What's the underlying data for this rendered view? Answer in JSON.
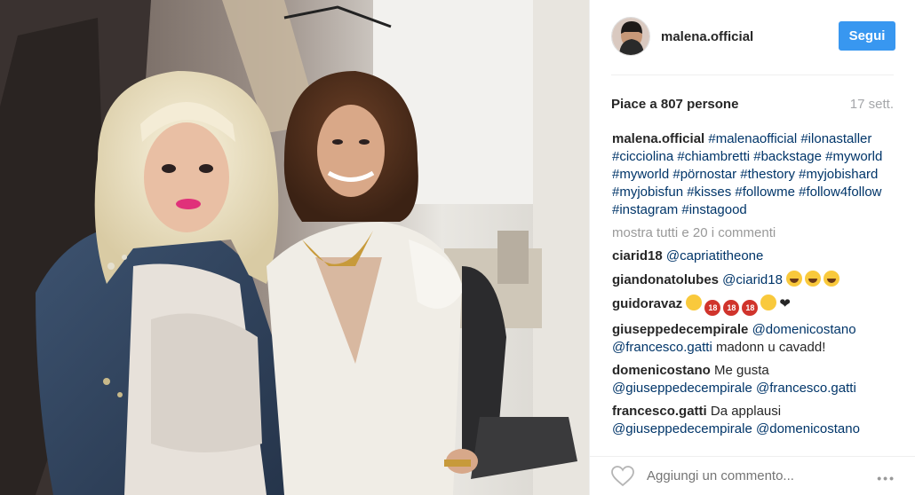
{
  "post": {
    "username": "malena.official",
    "follow_label": "Segui",
    "likes_text": "Piace a 807 persone",
    "time_text": "17 sett.",
    "load_more_text": "mostra tutti e 20 i commenti",
    "add_comment_placeholder": "Aggiungi un commento...",
    "more_options": "•••",
    "caption": {
      "user": "malena.official",
      "tags": [
        "#malenaofficial",
        "#ilonastaller",
        "#cicciolina",
        "#chiambretti",
        "#backstage",
        "#myworld",
        "#myworld",
        "#pörnostar",
        "#thestory",
        "#myjobishard",
        "#myjobisfun",
        "#kisses",
        "#followme",
        "#follow4follow",
        "#instagram",
        "#instagood"
      ]
    },
    "comments": [
      {
        "user": "ciarid18",
        "mention": "@capriatitheone",
        "text": ""
      },
      {
        "user": "giandonatolubes",
        "mention": "@ciarid18",
        "text": ""
      },
      {
        "user": "guidoravaz",
        "mention": "",
        "text": ""
      },
      {
        "user": "giuseppedecempirale",
        "mention": "@domenicostano",
        "mention2": "@francesco.gatti",
        "text": "madonn u cavadd!"
      },
      {
        "user": "domenicostano",
        "mention": "",
        "text": "Me gusta",
        "mention2": "@giuseppedecempirale",
        "mention3": "@francesco.gatti"
      },
      {
        "user": "francesco.gatti",
        "mention": "",
        "text": "Da applausi",
        "mention2": "@giuseppedecempirale",
        "mention3": "@domenicostano"
      }
    ]
  },
  "icons": {
    "like": "heart-outline-icon",
    "more": "more-options-icon"
  },
  "colors": {
    "follow_button": "#3897f0",
    "hashtag": "#003569",
    "muted": "#a5a7aa"
  }
}
